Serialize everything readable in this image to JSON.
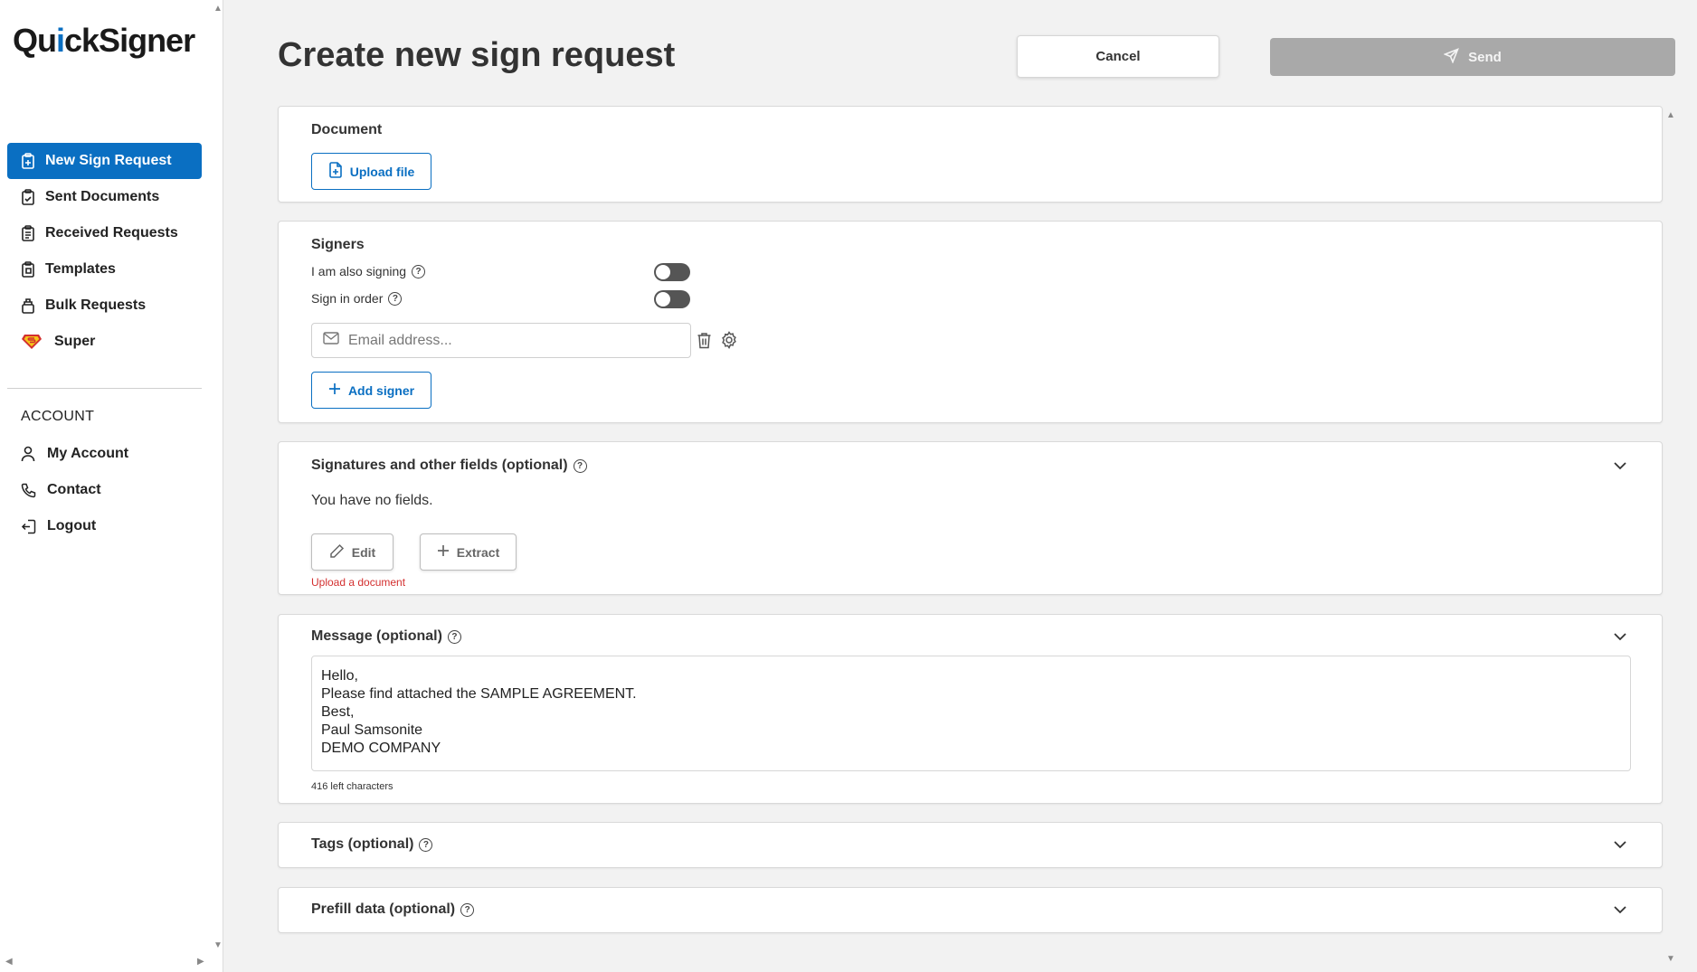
{
  "brand": {
    "name_start": "Qu",
    "name_dot": "i",
    "name_end": "ckSigner"
  },
  "nav": {
    "items": [
      {
        "label": "New Sign Request",
        "icon": "clipboard-plus-icon",
        "active": true
      },
      {
        "label": "Sent Documents",
        "icon": "clipboard-check-icon"
      },
      {
        "label": "Received Requests",
        "icon": "clipboard-list-icon"
      },
      {
        "label": "Templates",
        "icon": "clipboard-copy-icon"
      },
      {
        "label": "Bulk Requests",
        "icon": "stack-icon"
      },
      {
        "label": "Super",
        "icon": "superman-icon"
      }
    ],
    "account_heading": "ACCOUNT",
    "account_items": [
      {
        "label": "My Account",
        "icon": "user-icon"
      },
      {
        "label": "Contact",
        "icon": "phone-icon"
      },
      {
        "label": "Logout",
        "icon": "logout-icon"
      }
    ]
  },
  "header": {
    "title": "Create new sign request",
    "cancel_label": "Cancel",
    "send_label": "Send"
  },
  "document": {
    "title": "Document",
    "upload_label": "Upload file"
  },
  "signers": {
    "title": "Signers",
    "also_signing_label": "I am also signing",
    "sign_in_order_label": "Sign in order",
    "email_placeholder": "Email address...",
    "add_signer_label": "Add signer"
  },
  "fields": {
    "title": "Signatures and other fields (optional)",
    "empty_text": "You have no fields.",
    "edit_label": "Edit",
    "extract_label": "Extract",
    "warning": "Upload a document"
  },
  "message": {
    "title": "Message (optional)",
    "body": "Hello,\nPlease find attached the SAMPLE AGREEMENT.\nBest,\nPaul Samsonite\nDEMO COMPANY",
    "char_count": "416 left characters"
  },
  "tags": {
    "title": "Tags (optional)"
  },
  "prefill": {
    "title": "Prefill data (optional)"
  },
  "colors": {
    "primary": "#0a6fc2",
    "send_disabled": "#a9a9a9",
    "warning": "#d32f2f"
  }
}
